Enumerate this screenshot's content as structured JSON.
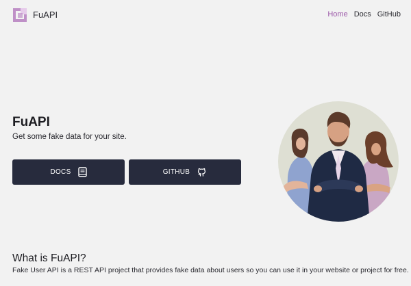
{
  "brand": {
    "name": "FuAPI",
    "logo_icon": "bracket-square-logo-icon",
    "logo_color": "#b67fc0"
  },
  "nav": {
    "links": [
      {
        "label": "Home",
        "active": true
      },
      {
        "label": "Docs",
        "active": false
      },
      {
        "label": "GitHub",
        "active": false
      }
    ],
    "active_color": "#9a55a7"
  },
  "hero": {
    "title": "FuAPI",
    "subtitle": "Get some fake data for your site.",
    "buttons": [
      {
        "label": "DOCS",
        "icon": "book-icon"
      },
      {
        "label": "GITHUB",
        "icon": "github-icon"
      }
    ],
    "button_color": "#272b3d"
  },
  "illustration": {
    "icon": "team-people-illustration-icon",
    "circle_color": "#dedfd3"
  },
  "about": {
    "title": "What is FuAPI?",
    "text": "Fake User API is a REST API project that provides fake data about users so you can use it in your website or project for free."
  }
}
